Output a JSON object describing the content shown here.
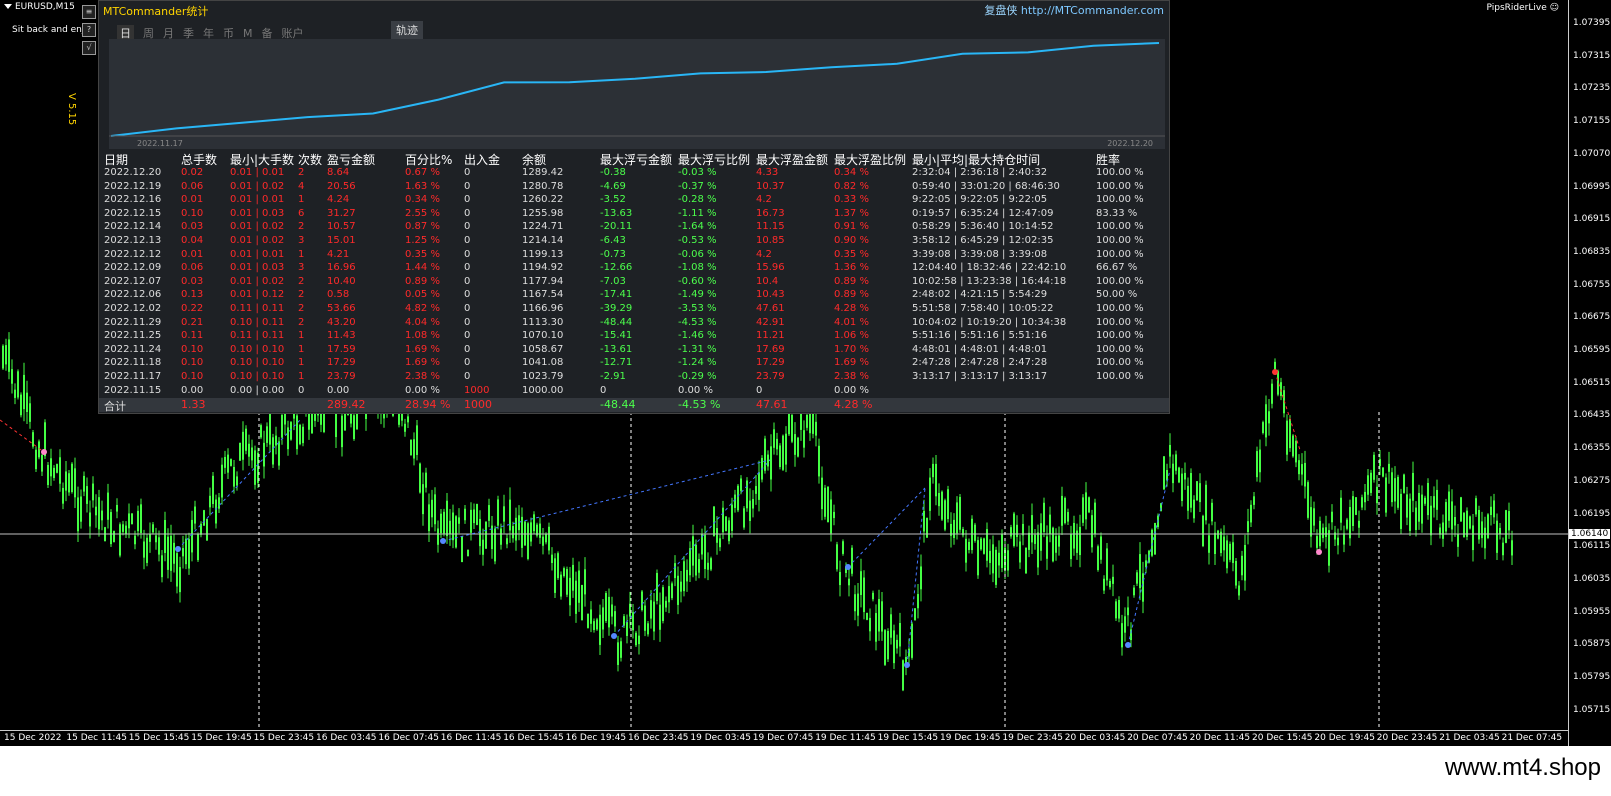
{
  "chart": {
    "symbol": "EURUSD,M15",
    "ea_name": "PipsRiderLive ☺",
    "slogan": "Sit back and enjoy the ride",
    "current_price": "1.06140",
    "price_ticks": [
      "1.07395",
      "1.07315",
      "1.07235",
      "1.07155",
      "1.07070",
      "1.06995",
      "1.06915",
      "1.06835",
      "1.06755",
      "1.06675",
      "1.06595",
      "1.06515",
      "1.06435",
      "1.06355",
      "1.06275",
      "1.06195",
      "1.06115",
      "1.06035",
      "1.05955",
      "1.05875",
      "1.05795",
      "1.05715"
    ],
    "time_ticks": [
      "15 Dec 2022",
      "15 Dec 11:45",
      "15 Dec 15:45",
      "15 Dec 19:45",
      "15 Dec 23:45",
      "16 Dec 03:45",
      "16 Dec 07:45",
      "16 Dec 11:45",
      "16 Dec 15:45",
      "16 Dec 19:45",
      "16 Dec 23:45",
      "19 Dec 03:45",
      "19 Dec 07:45",
      "19 Dec 11:45",
      "19 Dec 15:45",
      "19 Dec 19:45",
      "19 Dec 23:45",
      "20 Dec 03:45",
      "20 Dec 07:45",
      "20 Dec 11:45",
      "20 Dec 15:45",
      "20 Dec 19:45",
      "20 Dec 23:45",
      "21 Dec 03:45",
      "21 Dec 07:45"
    ],
    "colors": {
      "candle": "#44ff44",
      "background": "#000000",
      "price_line": "#c0c0c0",
      "trade_line": "#4477ff"
    }
  },
  "panel": {
    "title": "MTCommander统计",
    "link_cn": "复盘侠",
    "link_url": "http://MTCommander.com",
    "version": "V 5.15",
    "tabs": [
      "日",
      "周",
      "月",
      "季",
      "年",
      "币",
      "M",
      "备",
      "账户"
    ],
    "active_tab": "日",
    "track_tab": "轨迹",
    "side_buttons": [
      "≡",
      "?",
      "√"
    ],
    "equity_start_label": "2022.11.17",
    "equity_end_label": "2022.12.20",
    "headers": [
      "日期",
      "总手数",
      "最小|大手数",
      "次数",
      "盈亏金额",
      "百分比%",
      "出入金",
      "余额",
      "最大浮亏金额",
      "最大浮亏比例",
      "最大浮盈金额",
      "最大浮盈比例",
      "最小|平均|最大持仓时间",
      "胜率"
    ],
    "rows": [
      [
        "2022.12.20",
        "0.02",
        "0.01 | 0.01",
        "2",
        "8.64",
        "0.67 %",
        "0",
        "1289.42",
        "-0.38",
        "-0.03 %",
        "4.33",
        "0.34 %",
        "2:32:04 | 2:36:18 | 2:40:32",
        "100.00 %"
      ],
      [
        "2022.12.19",
        "0.06",
        "0.01 | 0.02",
        "4",
        "20.56",
        "1.63 %",
        "0",
        "1280.78",
        "-4.69",
        "-0.37 %",
        "10.37",
        "0.82 %",
        "0:59:40 | 33:01:20 | 68:46:30",
        "100.00 %"
      ],
      [
        "2022.12.16",
        "0.01",
        "0.01 | 0.01",
        "1",
        "4.24",
        "0.34 %",
        "0",
        "1260.22",
        "-3.52",
        "-0.28 %",
        "4.2",
        "0.33 %",
        "9:22:05 | 9:22:05 | 9:22:05",
        "100.00 %"
      ],
      [
        "2022.12.15",
        "0.10",
        "0.01 | 0.03",
        "6",
        "31.27",
        "2.55 %",
        "0",
        "1255.98",
        "-13.63",
        "-1.11 %",
        "16.73",
        "1.37 %",
        "0:19:57 | 6:35:24 | 12:47:09",
        "83.33 %"
      ],
      [
        "2022.12.14",
        "0.03",
        "0.01 | 0.02",
        "2",
        "10.57",
        "0.87 %",
        "0",
        "1224.71",
        "-20.11",
        "-1.64 %",
        "11.15",
        "0.91 %",
        "0:58:29 | 5:36:40 | 10:14:52",
        "100.00 %"
      ],
      [
        "2022.12.13",
        "0.04",
        "0.01 | 0.02",
        "3",
        "15.01",
        "1.25 %",
        "0",
        "1214.14",
        "-6.43",
        "-0.53 %",
        "10.85",
        "0.90 %",
        "3:58:12 | 6:45:29 | 12:02:35",
        "100.00 %"
      ],
      [
        "2022.12.12",
        "0.01",
        "0.01 | 0.01",
        "1",
        "4.21",
        "0.35 %",
        "0",
        "1199.13",
        "-0.73",
        "-0.06 %",
        "4.2",
        "0.35 %",
        "3:39:08 | 3:39:08 | 3:39:08",
        "100.00 %"
      ],
      [
        "2022.12.09",
        "0.06",
        "0.01 | 0.03",
        "3",
        "16.96",
        "1.44 %",
        "0",
        "1194.92",
        "-12.66",
        "-1.08 %",
        "15.96",
        "1.36 %",
        "12:04:40 | 18:32:46 | 22:42:10",
        "66.67 %"
      ],
      [
        "2022.12.07",
        "0.03",
        "0.01 | 0.02",
        "2",
        "10.40",
        "0.89 %",
        "0",
        "1177.94",
        "-7.03",
        "-0.60 %",
        "10.4",
        "0.89 %",
        "10:02:58 | 13:23:38 | 16:44:18",
        "100.00 %"
      ],
      [
        "2022.12.06",
        "0.13",
        "0.01 | 0.12",
        "2",
        "0.58",
        "0.05 %",
        "0",
        "1167.54",
        "-17.41",
        "-1.49 %",
        "10.43",
        "0.89 %",
        "2:48:02 | 4:21:15 | 5:54:29",
        "50.00 %"
      ],
      [
        "2022.12.02",
        "0.22",
        "0.11 | 0.11",
        "2",
        "53.66",
        "4.82 %",
        "0",
        "1166.96",
        "-39.29",
        "-3.53 %",
        "47.61",
        "4.28 %",
        "5:51:58 | 7:58:40 | 10:05:22",
        "100.00 %"
      ],
      [
        "2022.11.29",
        "0.21",
        "0.10 | 0.11",
        "2",
        "43.20",
        "4.04 %",
        "0",
        "1113.30",
        "-48.44",
        "-4.53 %",
        "42.91",
        "4.01 %",
        "10:04:02 | 10:19:20 | 10:34:38",
        "100.00 %"
      ],
      [
        "2022.11.25",
        "0.11",
        "0.11 | 0.11",
        "1",
        "11.43",
        "1.08 %",
        "0",
        "1070.10",
        "-15.41",
        "-1.46 %",
        "11.21",
        "1.06 %",
        "5:51:16 | 5:51:16 | 5:51:16",
        "100.00 %"
      ],
      [
        "2022.11.24",
        "0.10",
        "0.10 | 0.10",
        "1",
        "17.59",
        "1.69 %",
        "0",
        "1058.67",
        "-13.61",
        "-1.31 %",
        "17.69",
        "1.70 %",
        "4:48:01 | 4:48:01 | 4:48:01",
        "100.00 %"
      ],
      [
        "2022.11.18",
        "0.10",
        "0.10 | 0.10",
        "1",
        "17.29",
        "1.69 %",
        "0",
        "1041.08",
        "-12.71",
        "-1.24 %",
        "17.29",
        "1.69 %",
        "2:47:28 | 2:47:28 | 2:47:28",
        "100.00 %"
      ],
      [
        "2022.11.17",
        "0.10",
        "0.10 | 0.10",
        "1",
        "23.79",
        "2.38 %",
        "0",
        "1023.79",
        "-2.91",
        "-0.29 %",
        "23.79",
        "2.38 %",
        "3:13:17 | 3:13:17 | 3:13:17",
        "100.00 %"
      ],
      [
        "2022.11.15",
        "0.00",
        "0.00 | 0.00",
        "0",
        "0.00",
        "0.00 %",
        "1000",
        "1000.00",
        "0",
        "0.00 %",
        "0",
        "0.00 %",
        "",
        ""
      ]
    ],
    "total": [
      "合计",
      "1.33",
      "",
      "",
      "289.42",
      "28.94 %",
      "1000",
      "",
      "-48.44",
      "-4.53 %",
      "47.61",
      "4.28 %",
      "",
      ""
    ]
  },
  "footer": "www.mt4.shop"
}
